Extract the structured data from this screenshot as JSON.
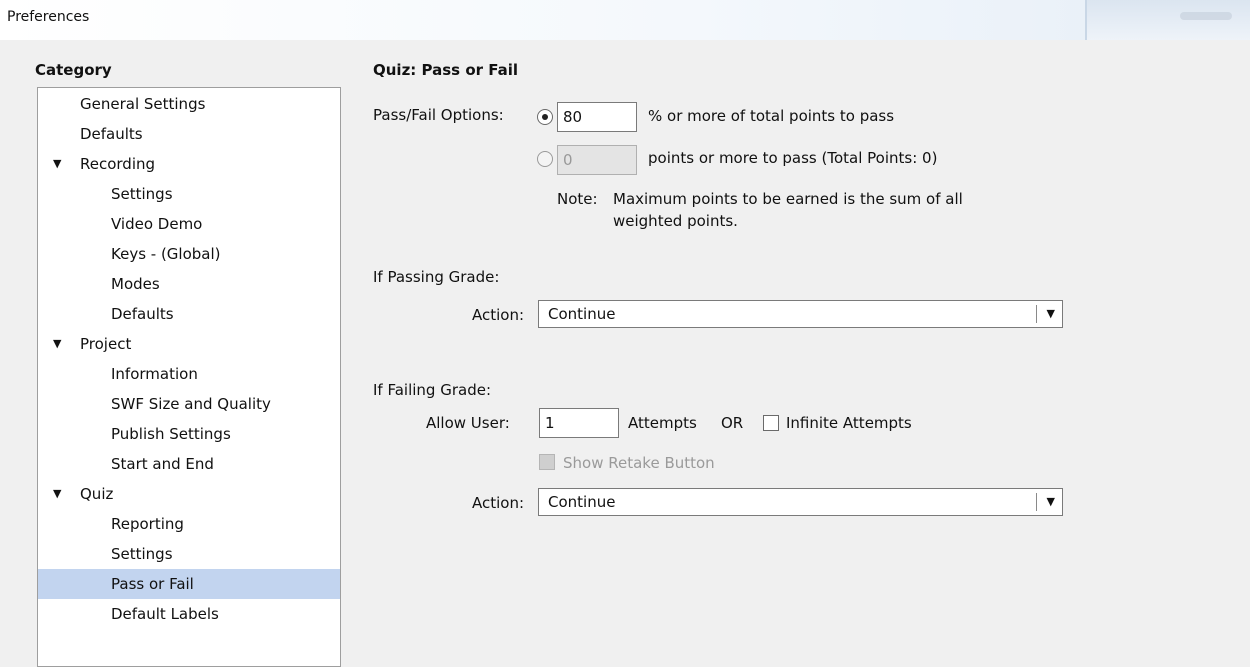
{
  "window": {
    "title": "Preferences"
  },
  "category": {
    "heading": "Category",
    "items": [
      {
        "label": "General Settings"
      },
      {
        "label": "Defaults"
      },
      {
        "label": "Recording",
        "expanded": true
      },
      {
        "label": "Settings"
      },
      {
        "label": "Video Demo"
      },
      {
        "label": "Keys - (Global)"
      },
      {
        "label": "Modes"
      },
      {
        "label": "Defaults"
      },
      {
        "label": "Project",
        "expanded": true
      },
      {
        "label": "Information"
      },
      {
        "label": "SWF Size and Quality"
      },
      {
        "label": "Publish Settings"
      },
      {
        "label": "Start and End"
      },
      {
        "label": "Quiz",
        "expanded": true
      },
      {
        "label": "Reporting"
      },
      {
        "label": "Settings"
      },
      {
        "label": "Pass or Fail",
        "selected": true
      },
      {
        "label": "Default Labels"
      }
    ],
    "expander_glyph": "▼"
  },
  "panel": {
    "heading": "Quiz: Pass or Fail",
    "pass_fail": {
      "label": "Pass/Fail Options:",
      "percent_value": "80",
      "percent_suffix": "% or more of total points to pass",
      "points_value": "0",
      "points_suffix": "points or more to pass (Total Points: 0)",
      "note_label": "Note:",
      "note_line1": "Maximum points to be earned is the sum of all",
      "note_line2": "weighted points."
    },
    "passing": {
      "heading": "If Passing Grade:",
      "action_label": "Action:",
      "action_value": "Continue"
    },
    "failing": {
      "heading": "If Failing Grade:",
      "allow_label": "Allow User:",
      "attempts_value": "1",
      "attempts_suffix": "Attempts",
      "or_label": "OR",
      "infinite_label": "Infinite Attempts",
      "retake_label": "Show Retake Button",
      "action_label": "Action:",
      "action_value": "Continue"
    },
    "dropdown_glyph": "▼"
  }
}
